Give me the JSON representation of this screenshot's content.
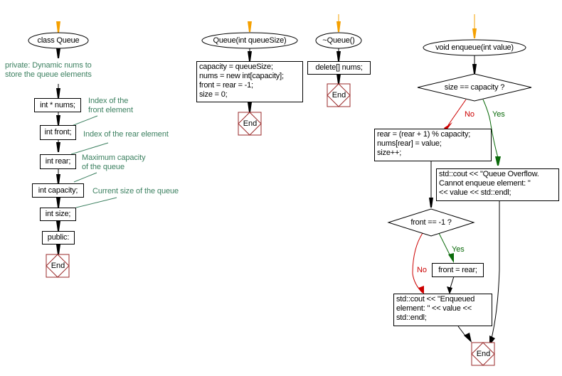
{
  "diagram": {
    "type": "flowchart",
    "flows": [
      {
        "id": "class",
        "start": "class Queue",
        "section_label": "private: Dynamic nums to\nstore the queue elements",
        "members": [
          "int * nums;",
          "int front;",
          "int rear;",
          "int capacity;",
          "int size;",
          "public:"
        ],
        "notes": [
          "Index of the\nfront element",
          "Index of the rear element",
          "Maximum capacity\nof the queue",
          "Current size of the queue"
        ],
        "end": "End"
      },
      {
        "id": "constructor",
        "start": "Queue(int queueSize)",
        "body": "capacity = queueSize;\nnums = new int[capacity];\nfront = rear = -1;\nsize = 0;",
        "end": "End"
      },
      {
        "id": "destructor",
        "start": "~Queue()",
        "body": "delete[] nums;",
        "end": "End"
      },
      {
        "id": "enqueue",
        "start": "void enqueue(int value)",
        "decision1": "size == capacity ?",
        "no1": "No",
        "yes1": "Yes",
        "no_body": "rear = (rear + 1) % capacity;\nnums[rear] = value;\nsize++;",
        "yes_body": "std::cout << \"Queue Overflow.\nCannot enqueue element: \"\n<< value << std::endl;",
        "decision2": "front == -1 ?",
        "yes2": "Yes",
        "no2": "No",
        "yes2_body": "front = rear;",
        "final_body": "std::cout << \"Enqueued\nelement: \" << value <<\nstd::endl;",
        "end": "End"
      }
    ],
    "colors": {
      "start_arrow": "#f5a000",
      "end_border": "#9a2a2a",
      "note_text": "#3c8060",
      "no": "#cc0000",
      "yes": "#0a6a0a"
    }
  }
}
